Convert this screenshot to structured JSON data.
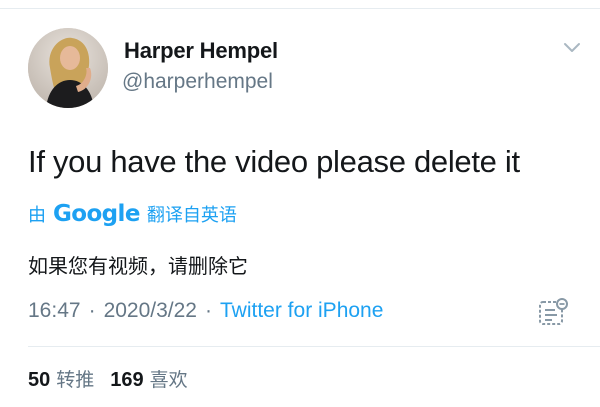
{
  "author": {
    "name": "Harper Hempel",
    "handle": "@harperhempel"
  },
  "tweet": {
    "text": "If you have the video please delete it"
  },
  "translation": {
    "prefix": "由",
    "provider": "Google",
    "suffix": "翻译自英语",
    "text": "如果您有视频，请删除它"
  },
  "meta": {
    "time": "16:47",
    "separator": "·",
    "date": "2020/3/22",
    "source": "Twitter for iPhone"
  },
  "stats": {
    "retweets": {
      "count": "50",
      "label": "转推"
    },
    "likes": {
      "count": "169",
      "label": "喜欢"
    }
  },
  "colors": {
    "link": "#1da1f2",
    "secondary_text": "#657786",
    "primary_text": "#14171a",
    "divider": "#e6ecf0"
  },
  "icons": {
    "menu": "chevron-down-icon",
    "analytics": "analytics-icon",
    "avatar": "avatar"
  }
}
